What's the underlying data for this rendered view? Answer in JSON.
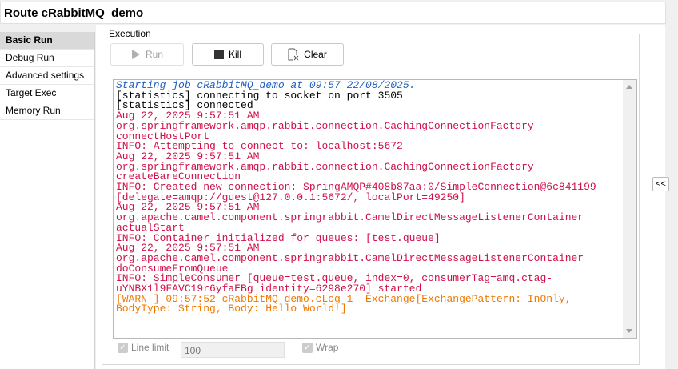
{
  "title": "Route cRabbitMQ_demo",
  "sidebar": {
    "items": [
      {
        "label": "Basic Run"
      },
      {
        "label": "Debug Run"
      },
      {
        "label": "Advanced settings"
      },
      {
        "label": "Target Exec"
      },
      {
        "label": "Memory Run"
      }
    ]
  },
  "execution": {
    "group_label": "Execution",
    "run_label": "Run",
    "kill_label": "Kill",
    "clear_label": "Clear",
    "console_lines": [
      {
        "text": "Starting job cRabbitMQ_demo at 09:57 22/08/2025.",
        "style": "blue"
      },
      {
        "text": "[statistics] connecting to socket on port 3505",
        "style": "black"
      },
      {
        "text": "[statistics] connected",
        "style": "black"
      },
      {
        "text": "Aug 22, 2025 9:57:51 AM",
        "style": "red"
      },
      {
        "text": "org.springframework.amqp.rabbit.connection.CachingConnectionFactory",
        "style": "red"
      },
      {
        "text": "connectHostPort",
        "style": "red"
      },
      {
        "text": "INFO: Attempting to connect to: localhost:5672",
        "style": "red"
      },
      {
        "text": "Aug 22, 2025 9:57:51 AM",
        "style": "red"
      },
      {
        "text": "org.springframework.amqp.rabbit.connection.CachingConnectionFactory",
        "style": "red"
      },
      {
        "text": "createBareConnection",
        "style": "red"
      },
      {
        "text": "INFO: Created new connection: SpringAMQP#408b87aa:0/SimpleConnection@6c841199",
        "style": "red"
      },
      {
        "text": "[delegate=amqp://guest@127.0.0.1:5672/, localPort=49250]",
        "style": "red"
      },
      {
        "text": "Aug 22, 2025 9:57:51 AM",
        "style": "red"
      },
      {
        "text": "org.apache.camel.component.springrabbit.CamelDirectMessageListenerContainer",
        "style": "red"
      },
      {
        "text": "actualStart",
        "style": "red"
      },
      {
        "text": "INFO: Container initialized for queues: [test.queue]",
        "style": "red"
      },
      {
        "text": "Aug 22, 2025 9:57:51 AM",
        "style": "red"
      },
      {
        "text": "org.apache.camel.component.springrabbit.CamelDirectMessageListenerContainer",
        "style": "red"
      },
      {
        "text": "doConsumeFromQueue",
        "style": "red"
      },
      {
        "text": "INFO: SimpleConsumer [queue=test.queue, index=0, consumerTag=amq.ctag-",
        "style": "red"
      },
      {
        "text": "uYNBX1l9FAVC19r6yfaEBg identity=6298e270] started",
        "style": "red"
      },
      {
        "text": "[WARN ] 09:57:52 cRabbitMQ_demo.cLog_1- Exchange[ExchangePattern: InOnly,",
        "style": "orange"
      },
      {
        "text": "BodyType: String, Body: Hello World!]",
        "style": "orange"
      }
    ],
    "line_limit_label": "Line limit",
    "line_limit_value": "100",
    "wrap_label": "Wrap"
  },
  "collapse_label": "<<"
}
